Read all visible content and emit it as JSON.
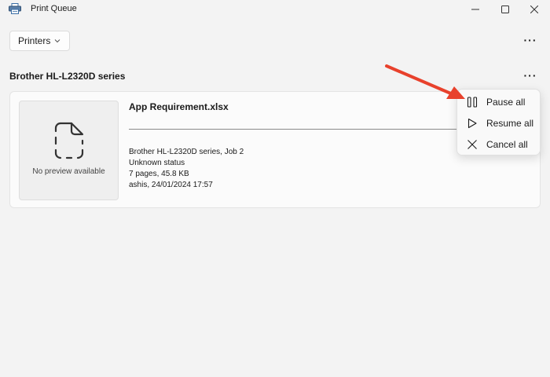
{
  "window": {
    "title": "Print Queue",
    "minimize_icon": "minimize-icon",
    "maximize_icon": "maximize-icon",
    "close_icon": "close-icon"
  },
  "toolbar": {
    "printers_label": "Printers",
    "more_glyph": "···"
  },
  "printer": {
    "name": "Brother HL-L2320D series",
    "more_glyph": "···"
  },
  "job": {
    "preview_text": "No preview available",
    "name": "App Requirement.xlsx",
    "printer_job": "Brother HL-L2320D series, Job 2",
    "status": "Unknown status",
    "size": "7 pages, 45.8 KB",
    "owner_time": "ashis, 24/01/2024 17:57",
    "progress": 1.0
  },
  "context_menu": {
    "items": [
      {
        "label": "Pause all",
        "icon": "pause-icon"
      },
      {
        "label": "Resume all",
        "icon": "play-icon"
      },
      {
        "label": "Cancel all",
        "icon": "cancel-icon"
      }
    ]
  },
  "colors": {
    "background": "#f3f3f3",
    "card": "#fbfbfb",
    "annotation_arrow": "#e8412c"
  }
}
